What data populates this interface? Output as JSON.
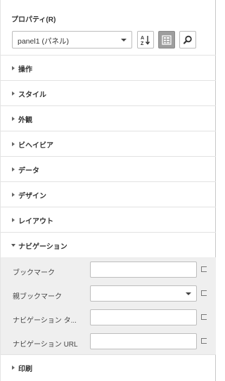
{
  "panel": {
    "title": "プロパティ(R)",
    "object_selector": {
      "value": "panel1 (パネル)"
    },
    "toolbar": {
      "sort_icon": "sort-az-icon",
      "categorized_icon": "categorized-view-icon",
      "search_icon": "search-icon"
    }
  },
  "sections": [
    {
      "label": "操作",
      "expanded": false
    },
    {
      "label": "スタイル",
      "expanded": false
    },
    {
      "label": "外観",
      "expanded": false
    },
    {
      "label": "ビヘイビア",
      "expanded": false
    },
    {
      "label": "データ",
      "expanded": false
    },
    {
      "label": "デザイン",
      "expanded": false
    },
    {
      "label": "レイアウト",
      "expanded": false
    },
    {
      "label": "ナビゲーション",
      "expanded": true
    },
    {
      "label": "印刷",
      "expanded": false
    }
  ],
  "navigation_properties": [
    {
      "label": "ブックマーク",
      "value": "",
      "type": "text"
    },
    {
      "label": "親ブックマーク",
      "value": "",
      "type": "select"
    },
    {
      "label": "ナビゲーション タ...",
      "value": "",
      "type": "text"
    },
    {
      "label": "ナビゲーション URL",
      "value": "",
      "type": "text"
    }
  ]
}
